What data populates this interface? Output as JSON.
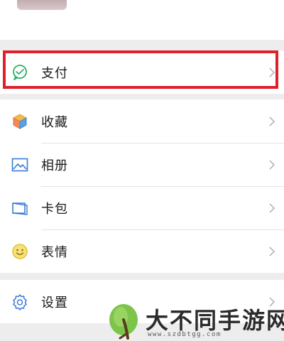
{
  "menu_group_pay": {
    "items": [
      {
        "label": "支付",
        "icon": "wechat-pay-icon"
      }
    ]
  },
  "menu_group_main": {
    "items": [
      {
        "label": "收藏",
        "icon": "favorites-cube-icon"
      },
      {
        "label": "相册",
        "icon": "album-image-icon"
      },
      {
        "label": "卡包",
        "icon": "card-wallet-icon"
      },
      {
        "label": "表情",
        "icon": "emoji-smile-icon"
      }
    ]
  },
  "menu_group_settings": {
    "items": [
      {
        "label": "设置",
        "icon": "settings-gear-icon"
      }
    ]
  },
  "colors": {
    "highlight_border": "#e0202a",
    "pay_green": "#2aae67",
    "emoji_yellow": "#e6c23a"
  },
  "watermark": {
    "title": "大不同手游网",
    "url": "www.szdbtgg.com"
  }
}
